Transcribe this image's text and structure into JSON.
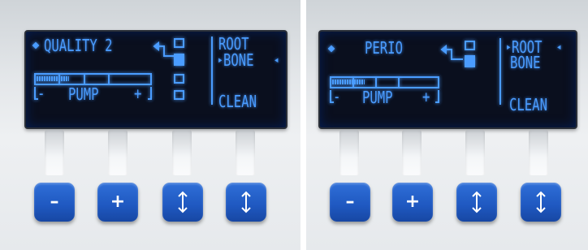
{
  "colors": {
    "lcd_bg": "#0a0f1e",
    "lcd_text": "#4a9cff",
    "button": "#1f58c0"
  },
  "left_display": {
    "mode_label": "QUALITY 2",
    "top_right": "ROOT",
    "middle_right": "BONE",
    "bottom_right": "CLEAN",
    "pump_label": "PUMP",
    "pump_minus": "-",
    "pump_plus": "+",
    "selected_mode": "BONE"
  },
  "right_display": {
    "mode_label": "PERIO",
    "top_right": "ROOT",
    "middle_right": "BONE",
    "bottom_right": "CLEAN",
    "pump_label": "PUMP",
    "pump_minus": "-",
    "pump_plus": "+",
    "selected_mode": "ROOT"
  },
  "buttons": {
    "minus_label": "–",
    "plus_label": "+",
    "up_down_icon": "up-down-arrow-icon"
  }
}
